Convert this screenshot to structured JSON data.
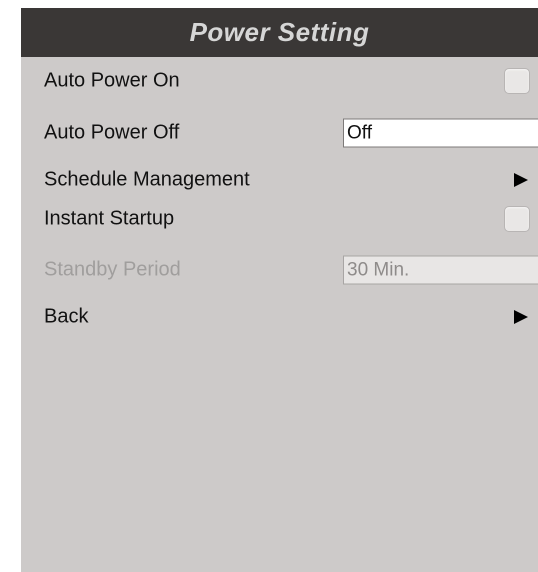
{
  "title": "Power Setting",
  "colors": {
    "title_bar": "#3a3736",
    "title_text": "#d6d6d6",
    "panel": "#cdcac9",
    "disabled_text": "#a09e9d"
  },
  "items": [
    {
      "label": "Auto Power On",
      "control": "checkbox",
      "checked": false,
      "enabled": true
    },
    {
      "label": "Auto Power Off",
      "control": "select",
      "value": "Off",
      "enabled": true
    },
    {
      "label": "Schedule Management",
      "control": "submenu-arrow",
      "enabled": true
    },
    {
      "label": "Instant Startup",
      "control": "checkbox",
      "checked": false,
      "enabled": true
    },
    {
      "label": "Standby Period",
      "control": "select",
      "value": "30 Min.",
      "enabled": false
    },
    {
      "label": "Back",
      "control": "submenu-arrow",
      "enabled": true
    }
  ]
}
